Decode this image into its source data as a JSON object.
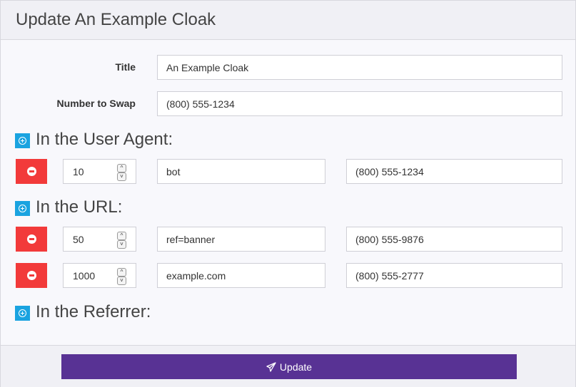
{
  "header": {
    "title": "Update An Example Cloak"
  },
  "form": {
    "title_label": "Title",
    "title_value": "An Example Cloak",
    "number_label": "Number to Swap",
    "number_value": "(800) 555-1234"
  },
  "sections": {
    "user_agent": {
      "title": "In the User Agent:",
      "rules": [
        {
          "weight": "10",
          "match": "bot",
          "number": "(800) 555-1234"
        }
      ]
    },
    "url": {
      "title": "In the URL:",
      "rules": [
        {
          "weight": "50",
          "match": "ref=banner",
          "number": "(800) 555-9876"
        },
        {
          "weight": "1000",
          "match": "example.com",
          "number": "(800) 555-2777"
        }
      ]
    },
    "referrer": {
      "title": "In the Referrer:",
      "rules": []
    }
  },
  "footer": {
    "update_label": "Update"
  },
  "icons": {
    "add": "plus-circle-icon",
    "remove": "minus-circle-icon",
    "spinner_up": "chevron-up-icon",
    "spinner_down": "chevron-down-icon",
    "submit": "paper-plane-icon"
  },
  "colors": {
    "add_button": "#1aa3e0",
    "remove_button": "#f23a3a",
    "update_button": "#583294"
  }
}
